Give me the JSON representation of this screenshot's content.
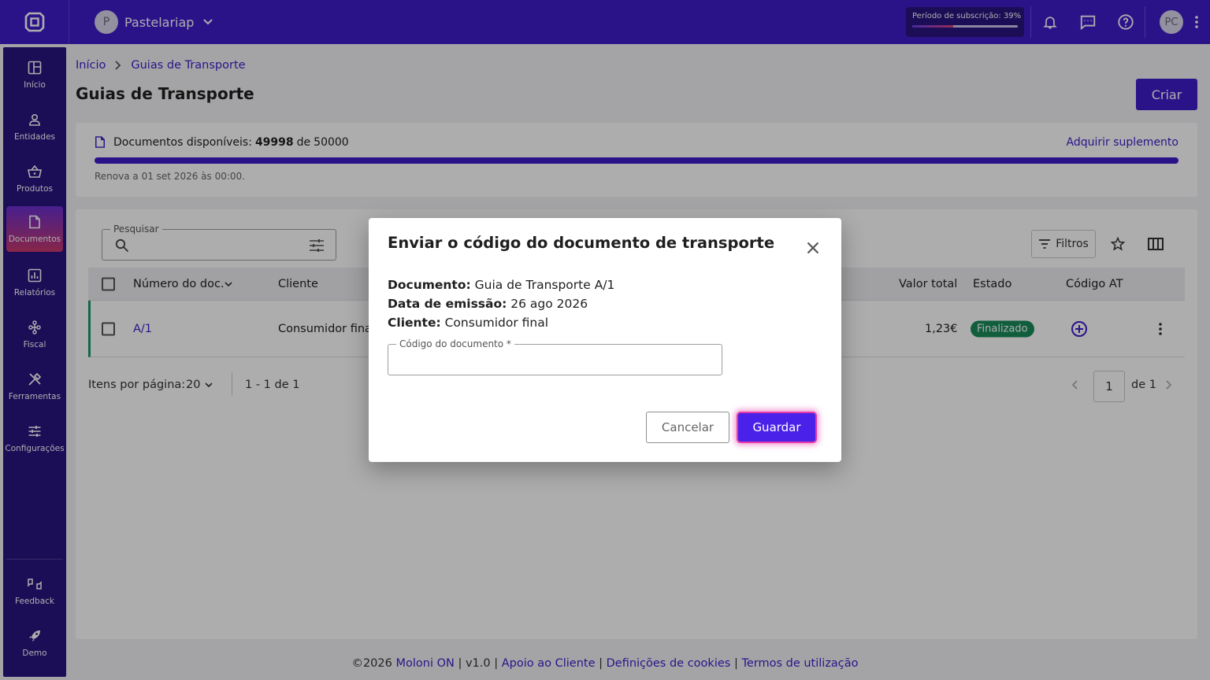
{
  "topbar": {
    "company_initial": "P",
    "company_name": "Pastelariap",
    "subscription_label": "Período de subscrição: 39%",
    "subscription_progress": 0.39,
    "user_initials": "PC"
  },
  "sidebar": {
    "items": [
      {
        "label": "Início",
        "icon": "dashboard-icon"
      },
      {
        "label": "Entidades",
        "icon": "user-icon"
      },
      {
        "label": "Produtos",
        "icon": "basket-icon"
      },
      {
        "label": "Documentos",
        "icon": "document-icon",
        "active": true
      },
      {
        "label": "Relatórios",
        "icon": "chart-icon"
      },
      {
        "label": "Fiscal",
        "icon": "fiscal-icon"
      },
      {
        "label": "Ferramentas",
        "icon": "tools-icon"
      },
      {
        "label": "Configurações",
        "icon": "sliders-icon"
      }
    ],
    "bottom": [
      {
        "label": "Feedback",
        "icon": "feedback-icon"
      },
      {
        "label": "Demo",
        "icon": "rocket-icon"
      }
    ]
  },
  "breadcrumb": {
    "home": "Início",
    "current": "Guias de Transporte"
  },
  "page": {
    "title": "Guias de Transporte",
    "create_label": "Criar"
  },
  "docs": {
    "label": "Documentos disponíveis:",
    "available": "49998",
    "of": "de",
    "total": "50000",
    "progress": 0.99996,
    "buy_label": "Adquirir suplemento",
    "renew": "Renova a 01 set 2026 às 00:00."
  },
  "table": {
    "search_label": "Pesquisar",
    "filters_label": "Filtros",
    "headers": {
      "number": "Número do doc.",
      "client": "Cliente",
      "total": "Valor total",
      "state": "Estado",
      "at": "Código AT"
    },
    "rows": [
      {
        "number": "A/1",
        "client": "Consumidor final",
        "total": "1,23€",
        "state": "Finalizado"
      }
    ],
    "pagination": {
      "per_page_label": "Itens por página:",
      "per_page": "20",
      "range": "1 - 1 de 1",
      "page": "1",
      "of_pages": "de 1"
    }
  },
  "footer": {
    "copyright": "©2026",
    "brand": "Moloni ON",
    "version": "v1.0",
    "support": "Apoio ao Cliente",
    "cookies": "Definições de cookies",
    "terms": "Termos de utilização",
    "sep": "|"
  },
  "modal": {
    "title": "Enviar o código do documento de transporte",
    "doc_label": "Documento:",
    "doc_value": "Guia de Transporte A/1",
    "date_label": "Data de emissão:",
    "date_value": "26 ago 2026",
    "client_label": "Cliente:",
    "client_value": "Consumidor final",
    "field_label": "Código do documento *",
    "field_value": "",
    "cancel_label": "Cancelar",
    "save_label": "Guardar"
  },
  "colors": {
    "primary": "#3f1dcb",
    "sidebar": "#2a1481",
    "success": "#1a8b5a",
    "highlight": "#e53aa8"
  }
}
